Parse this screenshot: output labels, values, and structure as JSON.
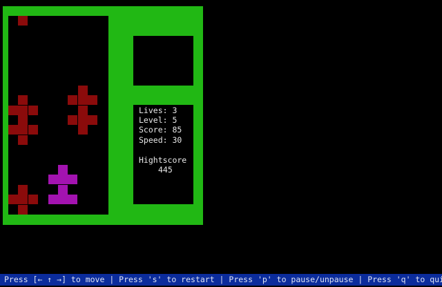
{
  "colors": {
    "frame": "#21b814",
    "well": "#000000",
    "dark_red_block": "#8b0b0b",
    "magenta_block": "#a313b0",
    "status_bar_bg": "#0b2c9c",
    "text": "#e8e8e8"
  },
  "stats": {
    "lives": "Lives: 3",
    "level": "Level: 5",
    "score": "Score: 85",
    "speed": "Speed: 30",
    "highscore_label": "Hightscore",
    "highscore_value": "445"
  },
  "pieces": [
    {
      "name": "falling-piece",
      "color": "#8b0b0b",
      "cells": [
        [
          1,
          0
        ]
      ]
    },
    {
      "name": "stacked-piece-left-upper",
      "color": "#8b0b0b",
      "cells": [
        [
          1,
          8
        ],
        [
          0,
          9
        ],
        [
          1,
          9
        ],
        [
          2,
          9
        ],
        [
          1,
          10
        ]
      ]
    },
    {
      "name": "stacked-piece-left-lower",
      "color": "#8b0b0b",
      "cells": [
        [
          0,
          11
        ],
        [
          1,
          11
        ],
        [
          2,
          11
        ],
        [
          1,
          12
        ]
      ]
    },
    {
      "name": "stacked-piece-right-upper",
      "color": "#8b0b0b",
      "cells": [
        [
          7,
          7
        ],
        [
          6,
          8
        ],
        [
          7,
          8
        ],
        [
          8,
          8
        ],
        [
          7,
          9
        ]
      ]
    },
    {
      "name": "stacked-piece-right-lower",
      "color": "#8b0b0b",
      "cells": [
        [
          6,
          10
        ],
        [
          7,
          10
        ],
        [
          8,
          10
        ],
        [
          7,
          11
        ]
      ]
    },
    {
      "name": "magenta-piece-top",
      "color": "#a313b0",
      "cells": [
        [
          5,
          15
        ],
        [
          4,
          16
        ],
        [
          5,
          16
        ],
        [
          6,
          16
        ]
      ]
    },
    {
      "name": "magenta-piece-bottom",
      "color": "#a313b0",
      "cells": [
        [
          5,
          17
        ],
        [
          4,
          18
        ],
        [
          5,
          18
        ],
        [
          6,
          18
        ]
      ]
    },
    {
      "name": "stacked-piece-bottom-left",
      "color": "#8b0b0b",
      "cells": [
        [
          1,
          17
        ],
        [
          0,
          18
        ],
        [
          1,
          18
        ],
        [
          2,
          18
        ],
        [
          1,
          19
        ]
      ]
    }
  ],
  "status_bar": {
    "text": "Press [← ↑ →] to move | Press 's' to restart | Press 'p' to pause/unpause | Press 'q' to quit"
  }
}
